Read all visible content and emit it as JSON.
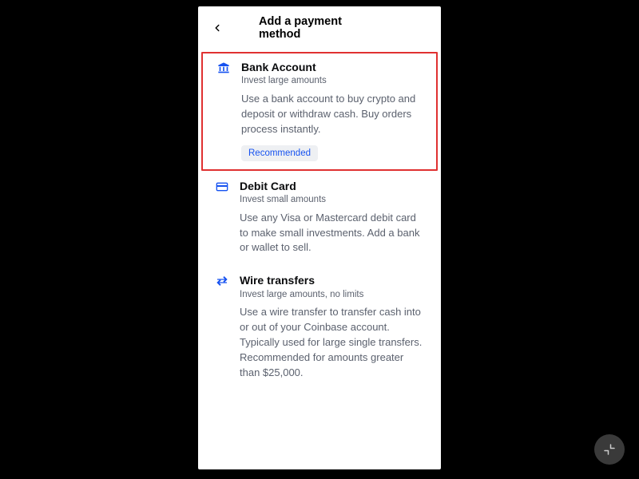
{
  "header": {
    "title": "Add a payment method"
  },
  "options": [
    {
      "title": "Bank Account",
      "subtitle": "Invest large amounts",
      "description": "Use a bank account to buy crypto and deposit or withdraw cash. Buy orders process instantly.",
      "badge": "Recommended"
    },
    {
      "title": "Debit Card",
      "subtitle": "Invest small amounts",
      "description": "Use any Visa or Mastercard debit card to make small investments. Add a bank or wallet to sell."
    },
    {
      "title": "Wire transfers",
      "subtitle": "Invest large amounts, no limits",
      "description": "Use a wire transfer to transfer cash into or out of your Coinbase account. Typically used for large single transfers. Recommended for amounts greater than $25,000."
    }
  ]
}
